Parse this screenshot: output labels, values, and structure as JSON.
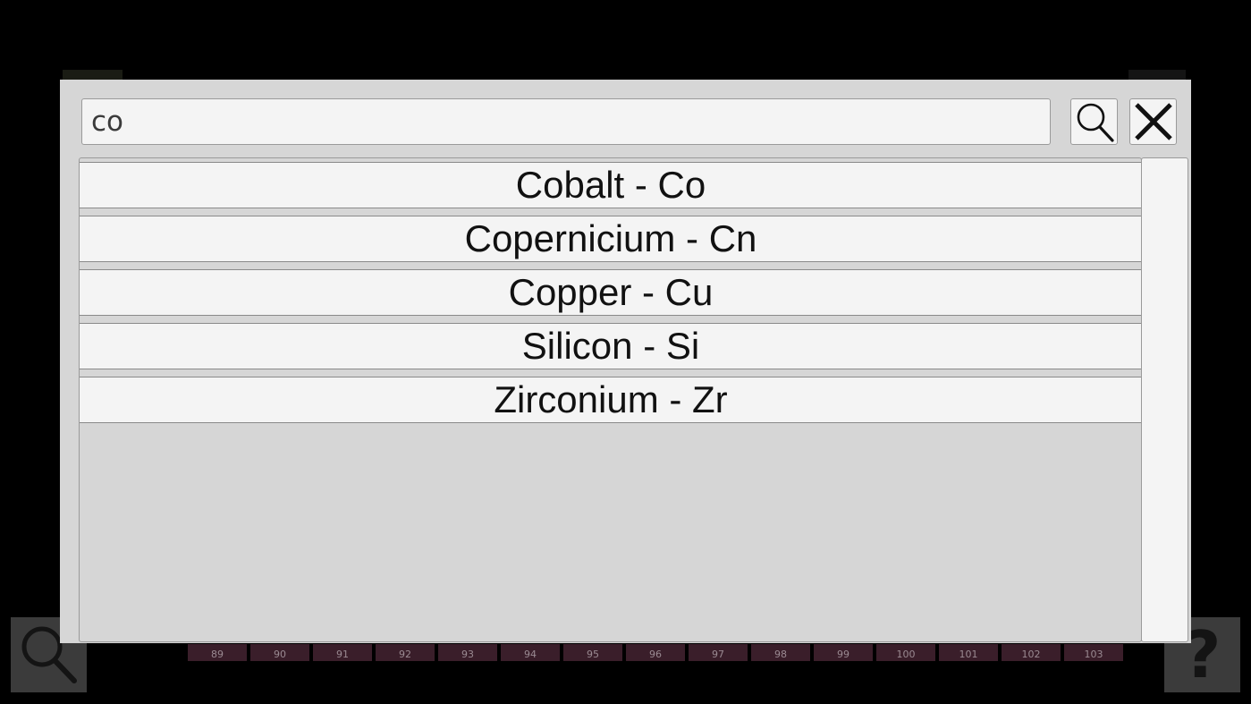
{
  "search": {
    "value": "co",
    "placeholder": ""
  },
  "results": [
    {
      "label": "Cobalt - Co"
    },
    {
      "label": "Copernicium - Cn"
    },
    {
      "label": "Copper - Cu"
    },
    {
      "label": "Silicon - Si"
    },
    {
      "label": "Zirconium - Zr"
    }
  ],
  "background_strip": {
    "cells": [
      "89",
      "90",
      "91",
      "92",
      "93",
      "94",
      "95",
      "96",
      "97",
      "98",
      "99",
      "100",
      "101",
      "102",
      "103"
    ]
  },
  "help_button": {
    "glyph": "?"
  },
  "icons": {
    "search": "search-icon",
    "close": "close-icon",
    "help": "help-icon"
  },
  "colors": {
    "dialog_bg": "#d6d6d6",
    "item_bg": "#f4f4f4",
    "page_bg": "#000000",
    "strip_cell": "#3a1e2a"
  }
}
